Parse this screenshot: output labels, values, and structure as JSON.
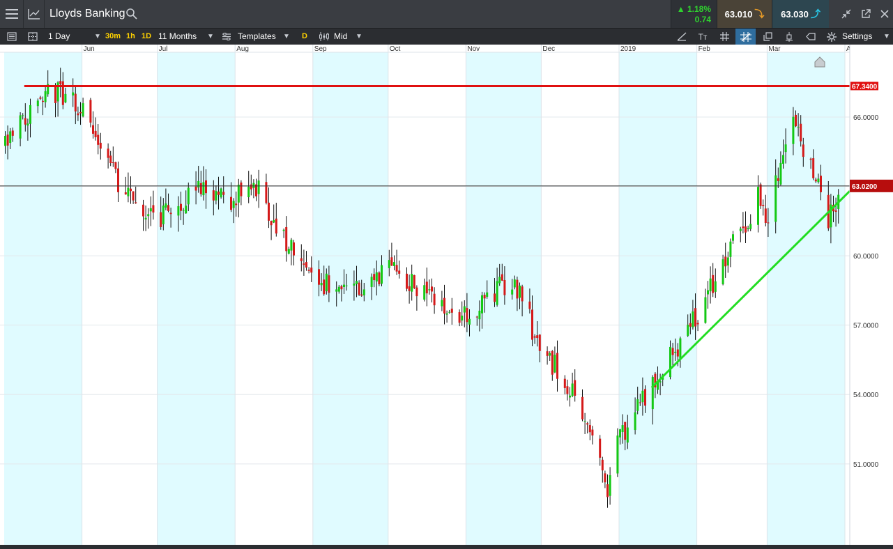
{
  "header": {
    "instrument": "Lloyds Banking",
    "change_pct": "▲ 1.18%",
    "change_abs": "0.74",
    "sell_price": "63.010",
    "buy_price": "63.030"
  },
  "toolbar": {
    "interval": "1 Day",
    "quick_30m": "30m",
    "quick_1h": "1h",
    "quick_1d": "1D",
    "range": "11 Months",
    "templates": "Templates",
    "d_badge": "D",
    "price_type": "Mid",
    "settings": "Settings"
  },
  "icons": {
    "menu": "menu-icon",
    "chart_type": "line-chart-icon",
    "search": "search-icon",
    "sell_arrow": "arrow-down-icon",
    "buy_arrow": "arrow-up-icon",
    "shrink": "shrink-icon",
    "popout": "popout-icon",
    "close": "close-icon",
    "layers": "layers-icon",
    "layout": "layout-icon",
    "interval_options": "clock-options-icon",
    "draw_line": "draw-line-icon",
    "text_size": "text-size-icon",
    "grid": "grid-icon",
    "crosshair": "crosshair-icon",
    "copy": "copy-icon",
    "candle_type": "candle-type-icon",
    "label": "label-icon",
    "settings": "gear-icon"
  },
  "colors": {
    "up": "#14c814",
    "down": "#d41919",
    "band": "#e0fbff",
    "resistance": "#e01010",
    "support": "#22dd22",
    "current_price_box": "#b70d0d"
  },
  "chart_data": {
    "type": "candlestick",
    "instrument": "Lloyds Banking",
    "interval": "1 Day",
    "x_labels": [
      "Jun",
      "Jul",
      "Aug",
      "Sep",
      "Oct",
      "Nov",
      "Dec",
      "2019",
      "Feb",
      "Mar",
      "Apr"
    ],
    "y_ticks": [
      "66.0000",
      "63.0000",
      "60.0000",
      "57.0000",
      "54.0000",
      "51.0000"
    ],
    "y_values": [
      66,
      63,
      60,
      57,
      54,
      51
    ],
    "ylim": [
      47.5,
      68.8
    ],
    "current_price": 63.02,
    "current_price_label": "63.0200",
    "resistance_level": 67.34,
    "resistance_label": "67.3400",
    "support_trendline": {
      "from": {
        "date": "2019-01-14",
        "price": 54.3
      },
      "to": {
        "date": "2019-04-04",
        "price": 62.8
      }
    },
    "month_closes": [
      {
        "month": "May 2018",
        "close": 66.5
      },
      {
        "month": "Jun 2018",
        "close": 61.5
      },
      {
        "month": "Jul 2018",
        "close": 62.5
      },
      {
        "month": "Aug 2018",
        "close": 59.0
      },
      {
        "month": "Sep 2018",
        "close": 59.5
      },
      {
        "month": "Oct 2018",
        "close": 57.5
      },
      {
        "month": "Nov 2018",
        "close": 56.0
      },
      {
        "month": "Dec 2018",
        "close": 52.0
      },
      {
        "month": "Jan 2019",
        "close": 57.3
      },
      {
        "month": "Feb 2019",
        "close": 61.5
      },
      {
        "month": "Mar 2019",
        "close": 63.02
      }
    ],
    "key_prices": [
      {
        "label": "high",
        "date": "2018-05-17",
        "price": 67.3
      },
      {
        "label": "low",
        "date": "2018-12-27",
        "price": 49.7
      },
      {
        "label": "mar_high",
        "date": "2019-03-11",
        "price": 66.0
      }
    ]
  }
}
